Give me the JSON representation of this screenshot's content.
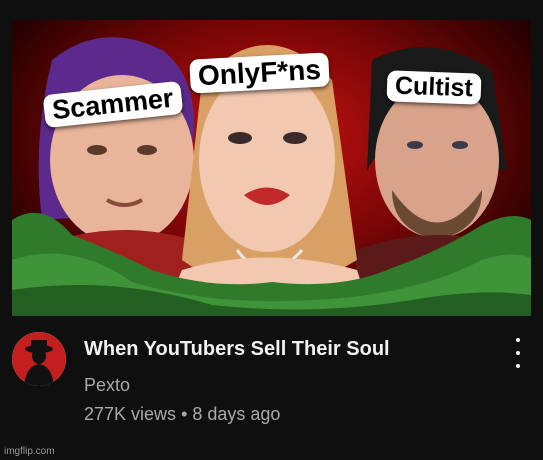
{
  "thumbnail": {
    "labels": {
      "left": "Scammer",
      "center": "OnlyF*ns",
      "right": "Cultist"
    }
  },
  "video": {
    "title": "When YouTubers Sell Their Soul",
    "channel": "Pexto",
    "views": "277K views",
    "separator": "•",
    "age": "8 days ago"
  },
  "menu": {
    "icon": "kebab-menu-icon"
  },
  "watermark": "imgflip.com",
  "colors": {
    "background": "#0f0f0f",
    "title": "#f1f1f1",
    "meta": "#aaaaaa",
    "thumbnail_bg": "#c81212",
    "money_green": "#2f7a2b"
  }
}
